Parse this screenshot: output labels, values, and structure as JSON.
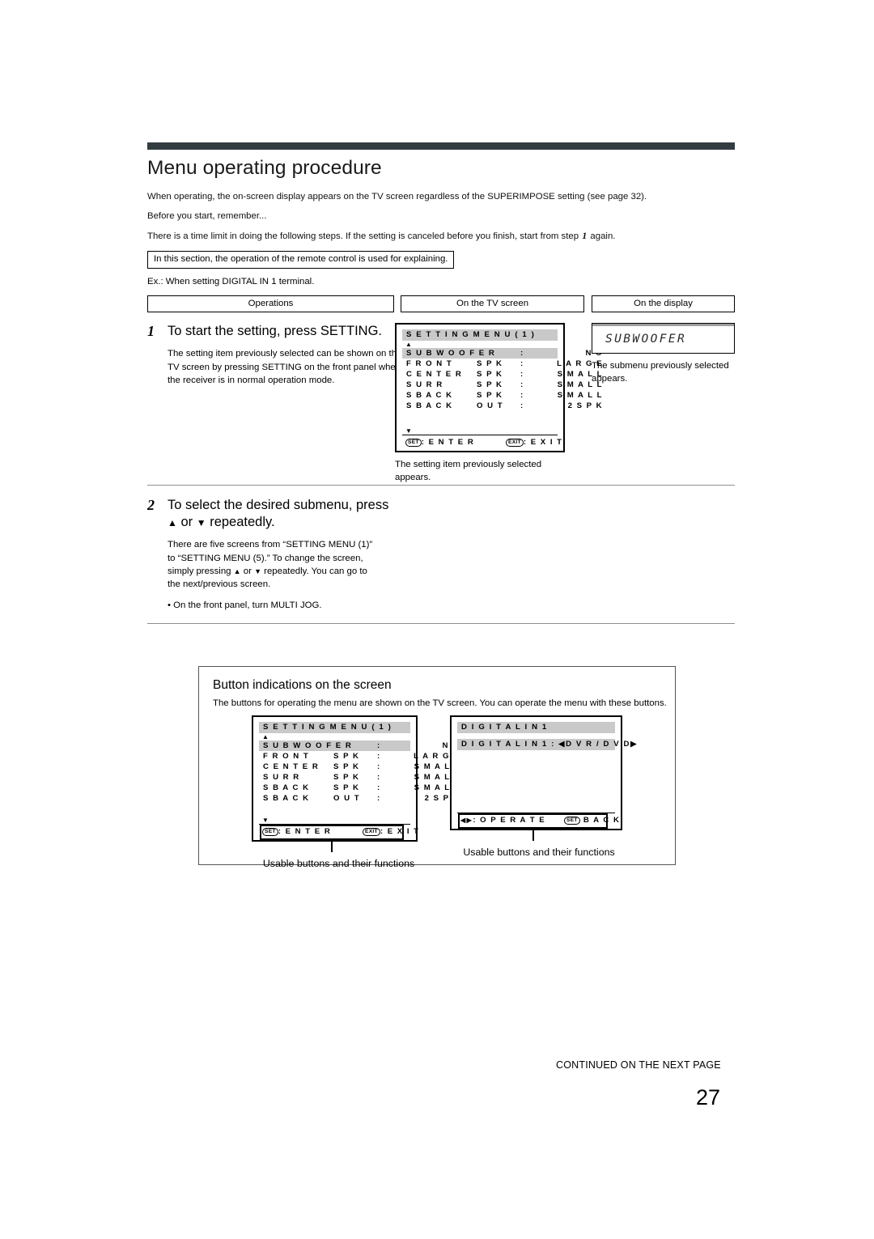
{
  "page": {
    "title": "Menu operating procedure",
    "intro": [
      "When operating, the on-screen display appears on the TV screen regardless of the SUPERIMPOSE setting (see page 32).",
      "Before you start, remember..."
    ],
    "time_limit_pre": "There is a time limit in doing the following steps. If the setting is canceled before you finish, start from step ",
    "time_limit_num": "1",
    "time_limit_post": " again.",
    "note_box": "In this section, the operation of the remote control is used for explaining.",
    "example_line": "Ex.: When setting DIGITAL IN 1 terminal.",
    "footer_note": "CONTINUED ON THE NEXT PAGE",
    "page_number": "27"
  },
  "columns": {
    "operations": "Operations",
    "tv_screen": "On the TV screen",
    "display": "On the display"
  },
  "steps": [
    {
      "number": "1",
      "heading": "To start the setting, press SETTING.",
      "body": "The setting item previously selected can be shown on the TV screen by pressing SETTING on the front panel when the receiver is in normal operation mode.",
      "tv_caption": "The setting item previously selected appears.",
      "display_caption": "The submenu previously selected appears."
    },
    {
      "number": "2",
      "heading_line1": "To select the desired submenu, press",
      "heading_line2_pre": "",
      "heading_up": "▲",
      "heading_or": " or ",
      "heading_down": "▼",
      "heading_line2_post": " repeatedly.",
      "body_line1": "There are five screens from “SETTING MENU (1)”",
      "body_line2": "to “SETTING MENU (5).” To change the screen,",
      "body_line3_pre": "simply pressing ",
      "body_line3_post": " repeatedly. You can go to",
      "body_line4": "the next/previous screen.",
      "bullet": "•  On the front panel, turn MULTI JOG."
    }
  ],
  "osd_setting_menu": {
    "title": "S E T T I N G   M E N U   ( 1 )",
    "arrow_up": "▲",
    "arrow_down": "▼",
    "rows": [
      {
        "c1": "S U B W O O F E R",
        "c2": "",
        "c3": ":",
        "c4": "N O",
        "highlighted": true
      },
      {
        "c1": "F R O N T",
        "c2": "S P K",
        "c3": ":",
        "c4": "L A R G E",
        "highlighted": false
      },
      {
        "c1": "C E N T E R",
        "c2": "S P K",
        "c3": ":",
        "c4": "S M A L L",
        "highlighted": false
      },
      {
        "c1": "S U R R",
        "c2": "S P K",
        "c3": ":",
        "c4": "S M A L L",
        "highlighted": false
      },
      {
        "c1": "S   B A C K",
        "c2": "S P K",
        "c3": ":",
        "c4": "S M A L L",
        "highlighted": false
      },
      {
        "c1": "S   B A C K",
        "c2": "O U T",
        "c3": ":",
        "c4": "2 S P K",
        "highlighted": false
      }
    ],
    "footer_left_key": "SET",
    "footer_left_label": ": E N T E R",
    "footer_right_key": "EXIT",
    "footer_right_label": ": E X I T"
  },
  "osd_digital_in": {
    "title": "D I G I T A L   I N   1",
    "row": "D I G I T A L   I N   1   :  ◀D V R / D V D▶",
    "footer_left_key": "◀▶",
    "footer_left_label": ": O P E R A T E",
    "footer_right_key": "SET",
    "footer_right_label": " B A C K"
  },
  "vfd": {
    "text": "SUBWOOFER"
  },
  "panel": {
    "title": "Button indications on the screen",
    "subtitle": "The buttons for operating the menu are shown on the TV screen. You can operate the menu with these buttons.",
    "caption_left": "Usable buttons and their functions",
    "caption_right": "Usable buttons and their functions"
  },
  "colors": {
    "rule_dark": "#333c40",
    "rule_grey": "#8f8f8f",
    "osd_highlight": "#c9c9c9"
  }
}
